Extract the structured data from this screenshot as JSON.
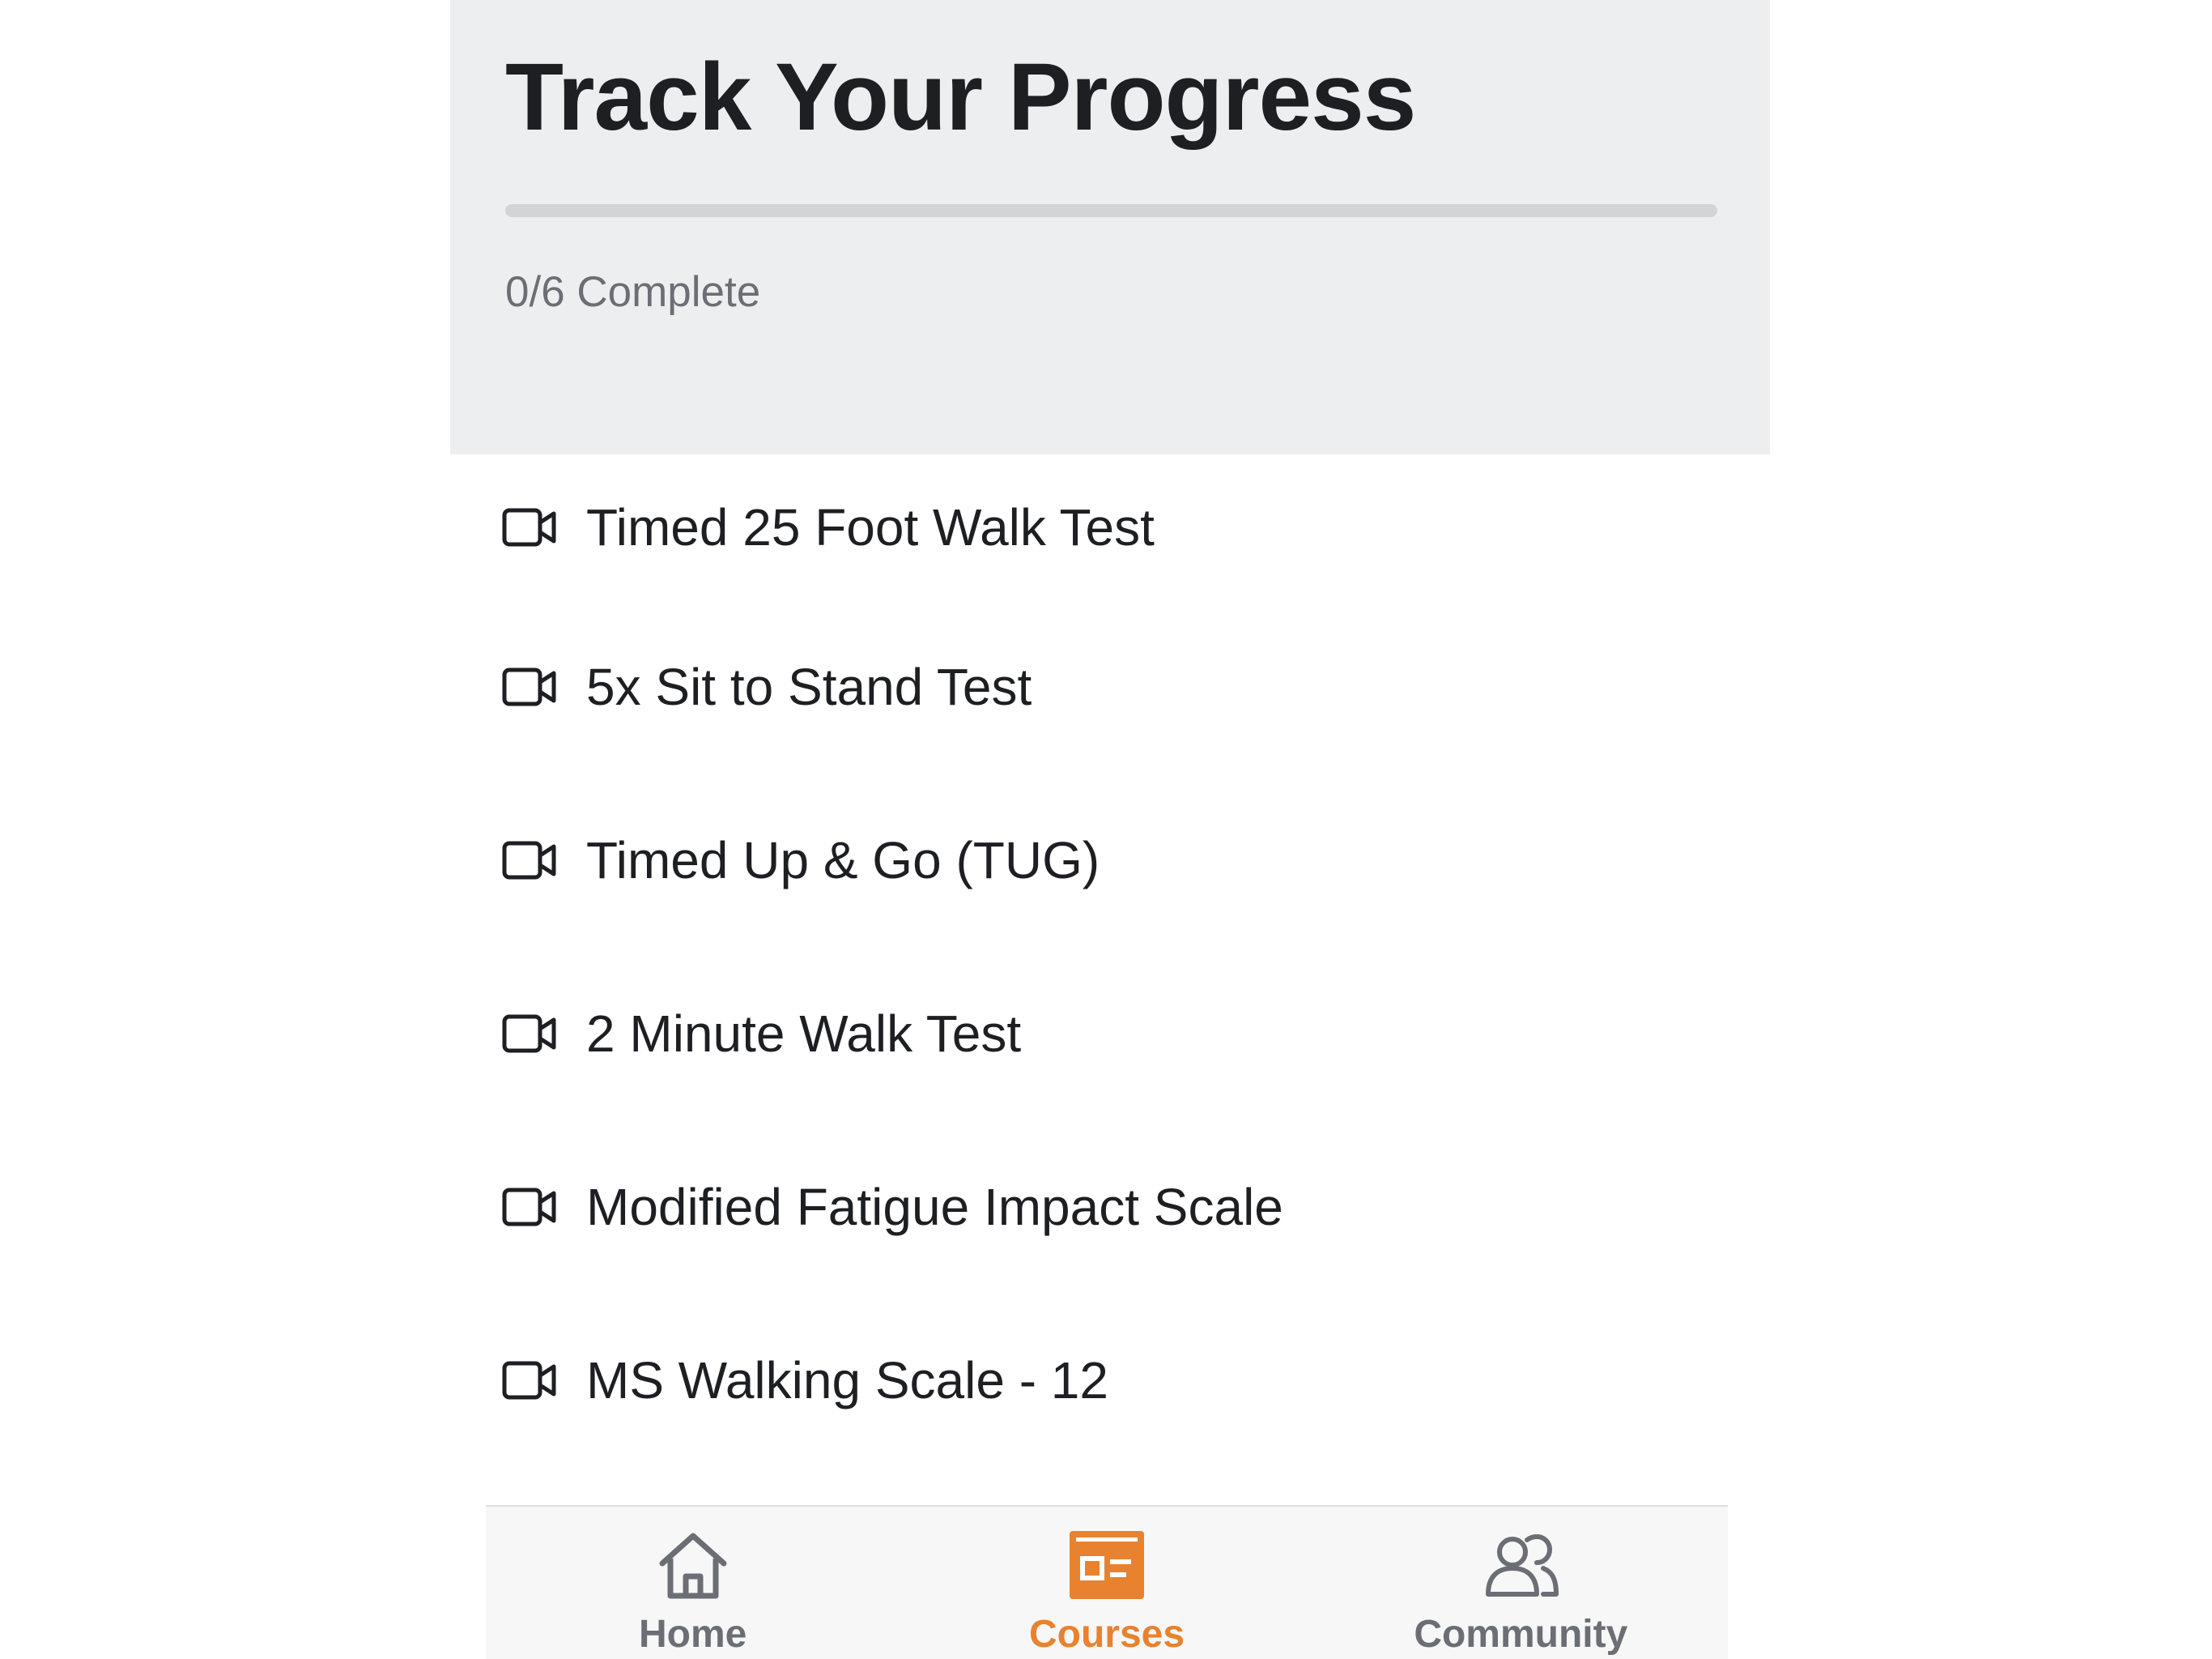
{
  "header": {
    "title": "Track Your Progress",
    "progress_text": "0/6 Complete",
    "progress_fraction": 0
  },
  "courses": [
    {
      "label": "Timed 25 Foot Walk Test",
      "icon": "video-camera-icon"
    },
    {
      "label": "5x Sit to Stand Test",
      "icon": "video-camera-icon"
    },
    {
      "label": "Timed Up & Go (TUG)",
      "icon": "video-camera-icon"
    },
    {
      "label": "2 Minute Walk Test",
      "icon": "video-camera-icon"
    },
    {
      "label": "Modified Fatigue Impact Scale",
      "icon": "video-camera-icon"
    },
    {
      "label": "MS Walking Scale - 12",
      "icon": "video-camera-icon"
    }
  ],
  "tabbar": {
    "tabs": [
      {
        "label": "Home",
        "icon": "home-icon",
        "active": false
      },
      {
        "label": "Courses",
        "icon": "courses-icon",
        "active": true
      },
      {
        "label": "Community",
        "icon": "community-icon",
        "active": false
      }
    ]
  },
  "colors": {
    "accent": "#e8822e",
    "header_bg": "#edeef0",
    "inactive_tab": "#6b6e74",
    "text": "#1d1f23"
  }
}
